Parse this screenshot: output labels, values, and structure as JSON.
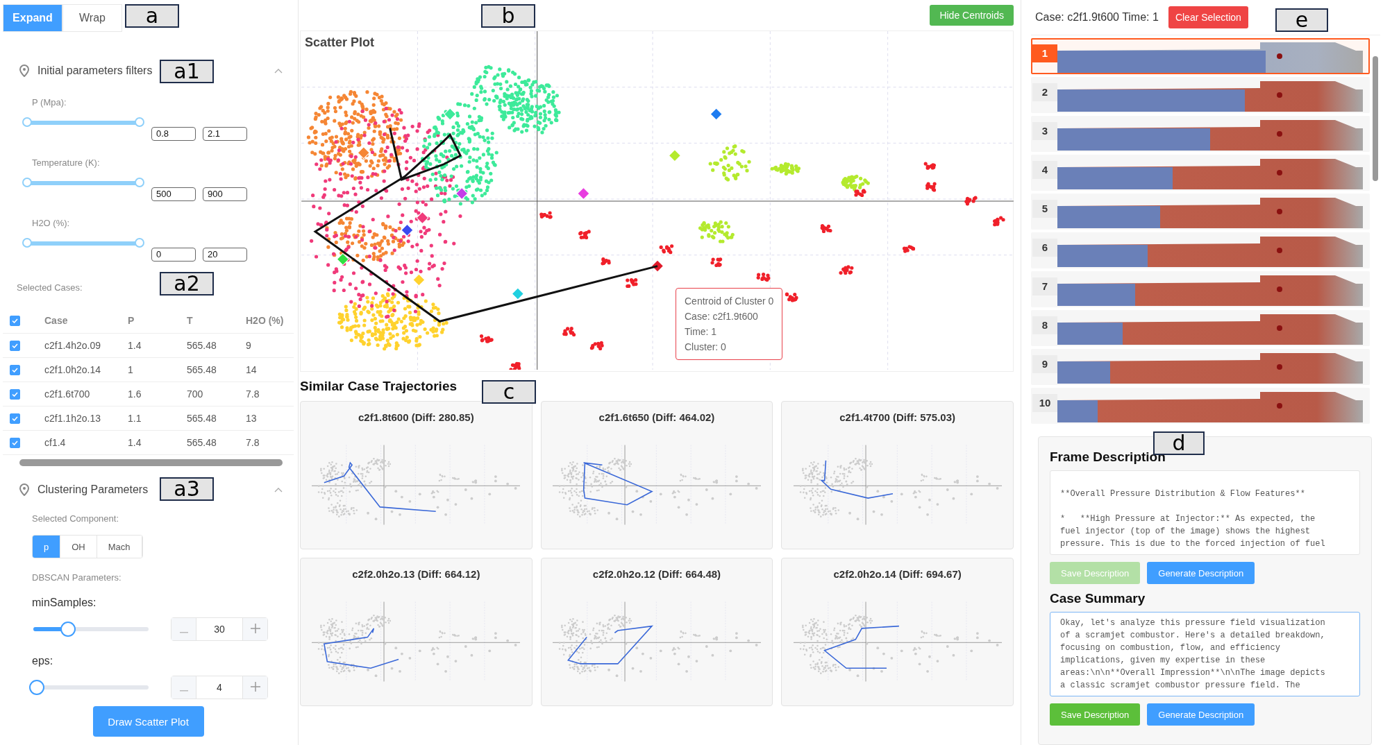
{
  "mode_tabs": [
    {
      "label": "Expand",
      "selected": true
    },
    {
      "label": "Wrap",
      "selected": false
    }
  ],
  "mode_marker": "a",
  "filters": {
    "title": "Initial parameters filters",
    "marker": "a1",
    "expanded": true,
    "params": [
      {
        "label": "P (Mpa):",
        "level": 1,
        "min": "0.8",
        "max": "2.1"
      },
      {
        "label": "Temperature (K):",
        "level": 1,
        "min": "500",
        "max": "900"
      },
      {
        "label": "H2O (%):",
        "level": 1,
        "min": "0",
        "max": "20"
      }
    ]
  },
  "selected_cases": {
    "label": "Selected Cases:",
    "marker": "a2",
    "all_checked": true,
    "columns": [
      "Case",
      "P",
      "T",
      "H2O (%)"
    ],
    "rows": [
      {
        "checked": true,
        "cells": [
          "c2f1.4h2o.09",
          "1.4",
          "565.48",
          "9"
        ]
      },
      {
        "checked": true,
        "cells": [
          "c2f1.0h2o.14",
          "1",
          "565.48",
          "14"
        ]
      },
      {
        "checked": true,
        "cells": [
          "c2f1.6t700",
          "1.6",
          "700",
          "7.8"
        ]
      },
      {
        "checked": true,
        "cells": [
          "c2f1.1h2o.13",
          "1.1",
          "565.48",
          "13"
        ]
      },
      {
        "checked": true,
        "cells": [
          "cf1.4",
          "1.4",
          "565.48",
          "7.8"
        ]
      }
    ]
  },
  "clustering": {
    "title": "Clustering Parameters",
    "marker": "a3",
    "expanded": true,
    "component_label": "Selected Component:",
    "components": [
      {
        "label": "p",
        "selected": true
      },
      {
        "label": "OH",
        "selected": false
      },
      {
        "label": "Mach",
        "selected": false
      }
    ],
    "dbscan_label": "DBSCAN Parameters:",
    "params": [
      {
        "label": "minSamples:",
        "level": 0.3,
        "value": "30"
      },
      {
        "label": "eps:",
        "level": 0.03,
        "value": "4"
      }
    ],
    "draw_button": "Draw Scatter Plot"
  },
  "scatter": {
    "marker": "b",
    "hide_button": "Hide Centroids",
    "title": "Scatter Plot",
    "tooltip": [
      "Centroid of Cluster 0",
      "Case: c2f1.9t600",
      "Time: 1",
      "Cluster: 0"
    ]
  },
  "similar": {
    "title": "Similar Case Trajectories",
    "marker": "c",
    "cards": [
      {
        "title": "c2f1.8t600 (Diff: 280.85)"
      },
      {
        "title": "c2f1.6t650 (Diff: 464.02)"
      },
      {
        "title": "c2f1.4t700 (Diff: 575.03)"
      },
      {
        "title": "c2f2.0h2o.13 (Diff: 664.12)"
      },
      {
        "title": "c2f2.0h2o.12 (Diff: 664.48)"
      },
      {
        "title": "c2f2.0h2o.14 (Diff: 694.67)"
      }
    ]
  },
  "frames": {
    "header": "Case: c2f1.9t600 Time: 1",
    "clear_button": "Clear Selection",
    "marker": "e",
    "items": [
      {
        "label": "1",
        "selected": true
      },
      {
        "label": "2",
        "selected": false
      },
      {
        "label": "3",
        "selected": false
      },
      {
        "label": "4",
        "selected": false
      },
      {
        "label": "5",
        "selected": false
      },
      {
        "label": "6",
        "selected": false
      },
      {
        "label": "7",
        "selected": false
      },
      {
        "label": "8",
        "selected": false
      },
      {
        "label": "9",
        "selected": false
      },
      {
        "label": "10",
        "selected": false
      }
    ]
  },
  "frame_description": {
    "title": "Frame Description",
    "marker": "d",
    "text": "\n**Overall Pressure Distribution & Flow Features**\n\n*   **High Pressure at Injector:** As expected, the\nfuel injector (top of the image) shows the highest\npressure. This is due to the forced injection of fuel",
    "focused": false,
    "buttons": [
      {
        "label": "Save Description",
        "kind": "save",
        "disabled": true
      },
      {
        "label": "Generate Description",
        "kind": "generate",
        "disabled": false
      }
    ]
  },
  "case_summary": {
    "title": "Case Summary",
    "text": "Okay, let's analyze this pressure field visualization\nof a scramjet combustor. Here's a detailed breakdown,\nfocusing on combustion, flow, and efficiency\nimplications, given my expertise in these\nareas:\\n\\n**Overall Impression**\\n\\nThe image depicts\na classic scramjet combustor pressure field. The",
    "focused": true,
    "buttons": [
      {
        "label": "Save Description",
        "kind": "save",
        "disabled": false
      },
      {
        "label": "Generate Description",
        "kind": "generate",
        "disabled": false
      }
    ]
  }
}
